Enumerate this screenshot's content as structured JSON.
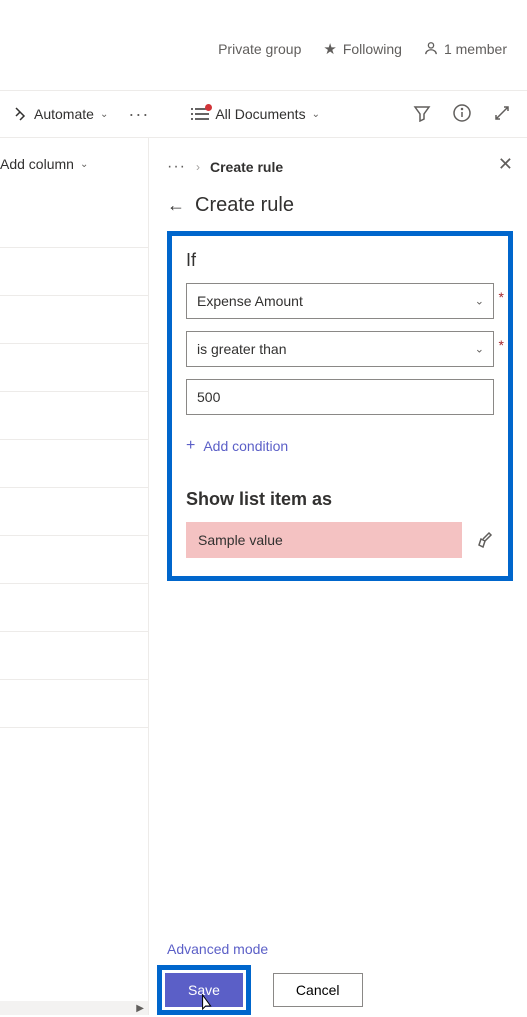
{
  "header": {
    "group_type": "Private group",
    "following_label": "Following",
    "member_label": "1 member"
  },
  "toolbar": {
    "automate_label": "Automate",
    "view_label": "All Documents"
  },
  "left": {
    "add_column_label": "Add column"
  },
  "panel": {
    "breadcrumb_current": "Create rule",
    "title": "Create rule",
    "if_label": "If",
    "column_value": "Expense Amount",
    "operator_value": "is greater than",
    "value_input": "500",
    "add_condition_label": "Add condition",
    "show_label": "Show list item as",
    "sample_label": "Sample value",
    "advanced_label": "Advanced mode",
    "save_label": "Save",
    "cancel_label": "Cancel"
  }
}
